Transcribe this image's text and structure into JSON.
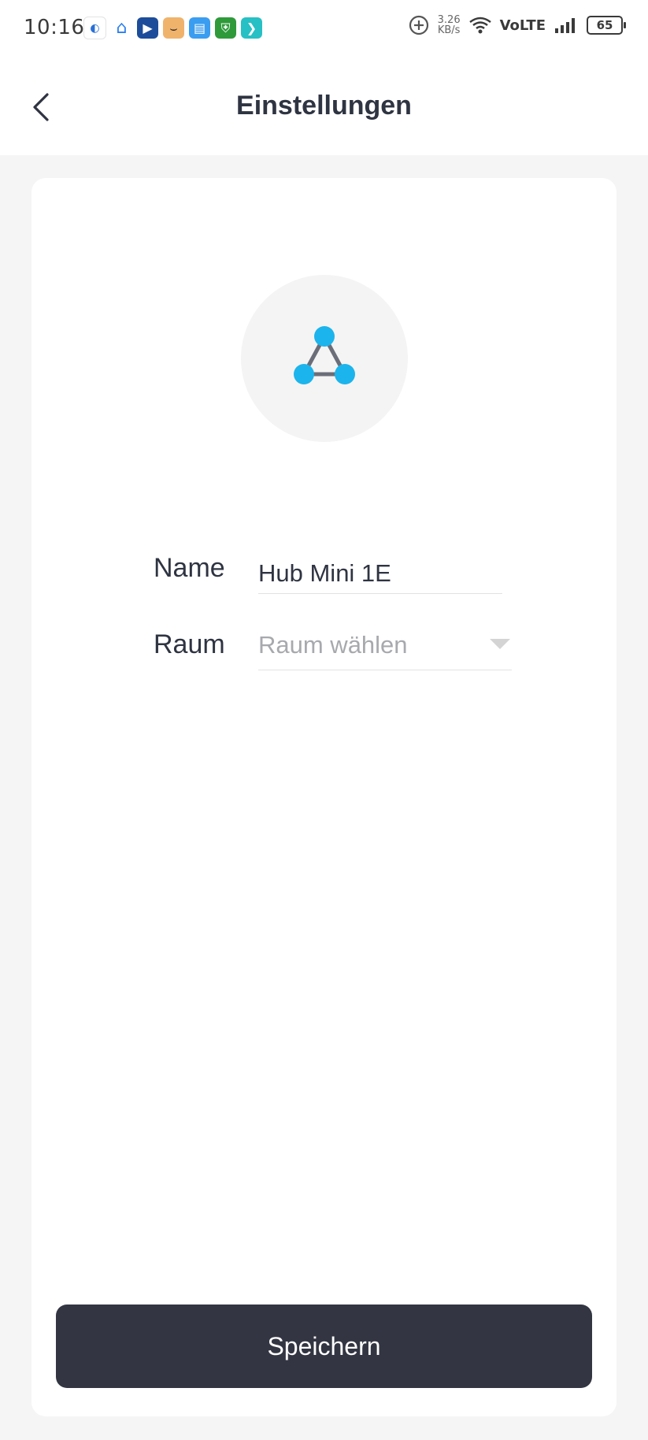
{
  "status_bar": {
    "time": "10:16",
    "speed_value": "3.26",
    "speed_unit": "KB/s",
    "network_label": "VoLTE",
    "battery_level": "65",
    "notification_icons": [
      "browser-icon",
      "home-icon",
      "video-icon",
      "amazon-icon",
      "clipboard-icon",
      "shield-icon",
      "app-icon"
    ]
  },
  "header": {
    "title": "Einstellungen",
    "back_icon": "chevron-left-icon"
  },
  "device": {
    "icon": "hub-network-icon",
    "colors": {
      "node": "#1cb4ec",
      "edge": "#6b6e78",
      "circle_bg": "#f4f4f4"
    }
  },
  "form": {
    "name_label": "Name",
    "name_value": "Hub Mini 1E",
    "room_label": "Raum",
    "room_placeholder": "Raum wählen"
  },
  "actions": {
    "save_label": "Speichern",
    "save_color": "#333642"
  }
}
